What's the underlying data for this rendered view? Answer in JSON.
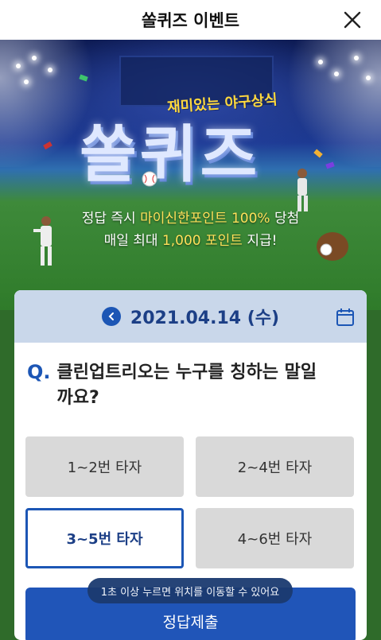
{
  "header": {
    "title": "쏠퀴즈 이벤트",
    "close_icon": "close-icon"
  },
  "banner": {
    "subtitle": "재미있는 야구상식",
    "logo": "쏠퀴즈",
    "promo_line1_prefix": "정답 즉시 ",
    "promo_line1_highlight": "마이신한포인트 100%",
    "promo_line1_suffix": " 당첨",
    "promo_line2_prefix": "매일 최대 ",
    "promo_line2_highlight": "1,000 포인트",
    "promo_line2_suffix": " 지급!",
    "highlight_color": "#ffe15a"
  },
  "quiz": {
    "date": "2021.04.14 (수)",
    "prev_icon": "chevron-left-icon",
    "calendar_icon": "calendar-icon",
    "question_marker": "Q.",
    "question_line1": "클린업트리오는 누구를 칭하는 말일",
    "question_line2": "까요?",
    "options": [
      "1~2번 타자",
      "2~4번 타자",
      "3~5번 타자",
      "4~6번 타자"
    ],
    "selected_option": "3~5번 타자",
    "submit_label": "정답제출",
    "tooltip": "1초 이상 누르면 위치를 이동할 수 있어요",
    "accent_color": "#1c56b5"
  }
}
